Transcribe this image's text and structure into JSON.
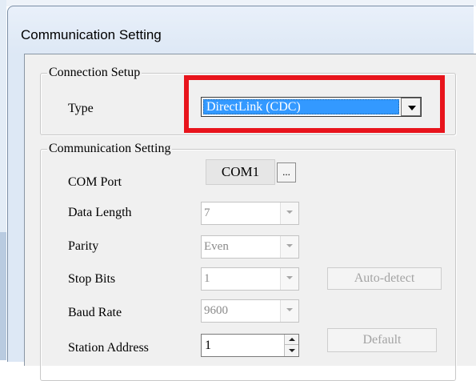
{
  "window": {
    "title": "Communication Setting"
  },
  "connection_setup": {
    "legend": "Connection Setup",
    "type_label": "Type",
    "type_value": "DirectLink (CDC)"
  },
  "communication_setting": {
    "legend": "Communication Setting",
    "com_port": {
      "label": "COM Port",
      "value": "COM1",
      "browse_label": "..."
    },
    "data_length": {
      "label": "Data Length",
      "value": "7"
    },
    "parity": {
      "label": "Parity",
      "value": "Even"
    },
    "stop_bits": {
      "label": "Stop Bits",
      "value": "1"
    },
    "baud_rate": {
      "label": "Baud Rate",
      "value": "9600"
    },
    "station_address": {
      "label": "Station Address",
      "value": "1"
    },
    "auto_detect_label": "Auto-detect",
    "default_label": "Default"
  },
  "colors": {
    "highlight_border": "#e8141c",
    "selection": "#3399ff",
    "disabled_text": "#a3a3a3"
  }
}
